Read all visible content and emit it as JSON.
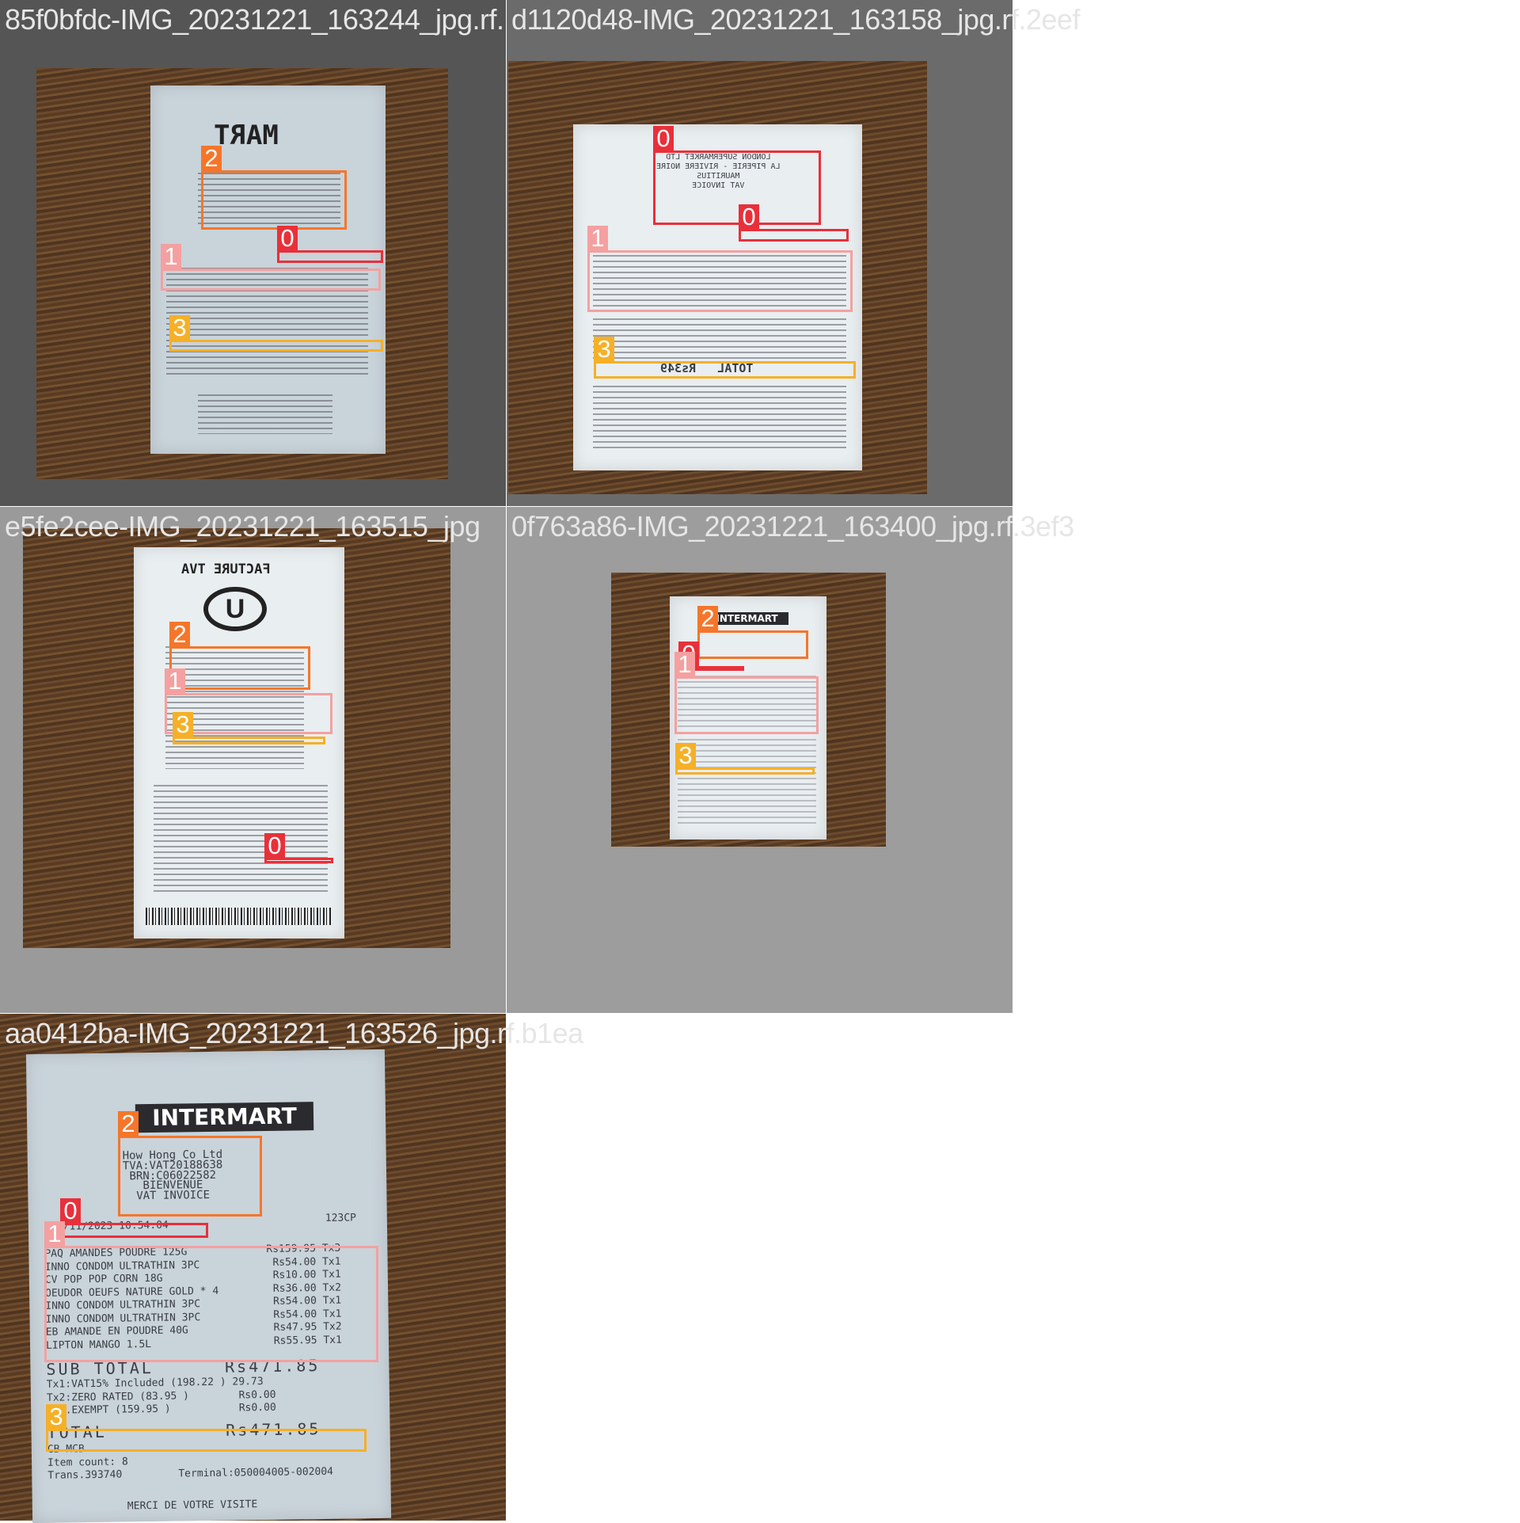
{
  "tiles": [
    {
      "title": "85f0bfdc-IMG_20231221_163244_jpg.rf.",
      "logo": "MART",
      "labels": [
        "2",
        "0",
        "1",
        "3"
      ]
    },
    {
      "title": "d1120d48-IMG_20231221_163158_jpg.rf.2eef",
      "header": [
        "LONDON SUPERMARKET LTD",
        "LA PIPERIE - RIVIERE NOIRE",
        "MAURITIUS",
        "VAT INVOICE"
      ],
      "total": "TOTAL   Rs349",
      "labels": [
        "0",
        "0",
        "1",
        "3"
      ]
    },
    {
      "title": "e5fe2cee-IMG_20231221_163515_jpg",
      "logo": "FACTURE TVA",
      "brand": "U",
      "labels": [
        "2",
        "1",
        "3",
        "0"
      ]
    },
    {
      "title": "0f763a86-IMG_20231221_163400_jpg.rf.3ef3",
      "logo": "INTERMART",
      "labels": [
        "2",
        "0",
        "1",
        "3"
      ]
    },
    {
      "title": "aa0412ba-IMG_20231221_163526_jpg.rf.b1ea",
      "logo": "INTERMART",
      "header": "How Hong Co Ltd\nTVA:VAT20188638\nBRN:C06022582\nBIENVENUE\nVAT INVOICE",
      "date": "5/11/2023 10:54:04",
      "code": "123CP",
      "items": "PAQ AMANDES POUDRE 125G\nINNO CONDOM ULTRATHIN 3PC\nCV POP POP CORN 18G\nOEUDOR OEUFS NATURE GOLD * 4\nINNO CONDOM ULTRATHIN 3PC\nINNO CONDOM ULTRATHIN 3PC\nEB AMANDE EN POUDRE 40G\nLIPTON MANGO 1.5L",
      "prices": "Rs159.95 Tx3\n Rs54.00 Tx1\n Rs10.00 Tx1\n Rs36.00 Tx2\n Rs54.00 Tx1\n Rs54.00 Tx1\n Rs47.95 Tx2\n Rs55.95 Tx1",
      "subtotal": "SUB TOTAL      Rs471.85",
      "tax": "Tx1:VAT15% Included (198.22 ) 29.73\nTx2:ZERO RATED (83.95 )        Rs0.00\nTx3.EXEMPT (159.95 )           Rs0.00",
      "total": "TOTAL          Rs471.85",
      "footer": "CB MCB\nItem count: 8\nTrans.393740",
      "terminal": "Terminal:050004005-002004",
      "thanks": "MERCI DE VOTRE VISITE",
      "labels": [
        "2",
        "0",
        "1",
        "3"
      ]
    }
  ]
}
